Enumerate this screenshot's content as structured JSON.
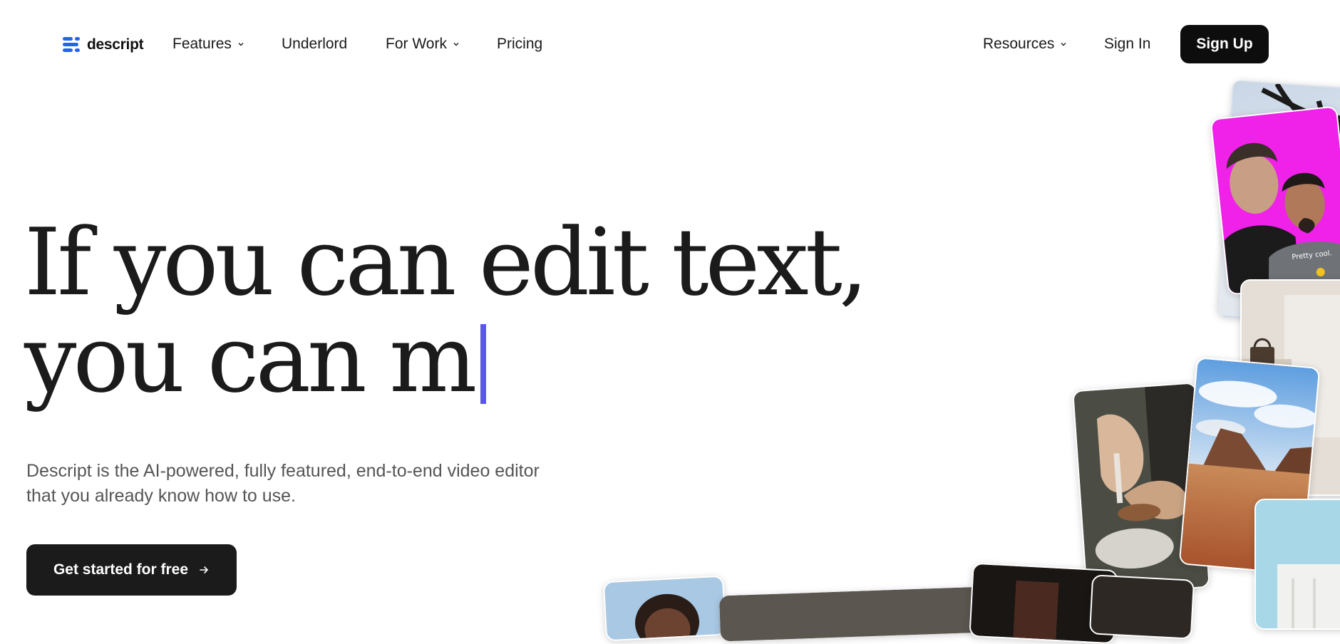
{
  "brand": {
    "name": "descript",
    "accent": "#2463eb"
  },
  "nav": {
    "features": "Features",
    "underlord": "Underlord",
    "for_work": "For Work",
    "pricing": "Pricing",
    "resources": "Resources",
    "sign_in": "Sign In",
    "sign_up": "Sign Up"
  },
  "hero": {
    "headline_line1": "If you can edit text,",
    "headline_line2": "you can m",
    "subtext_line1": "Descript is the AI-powered, fully featured, end-to-end video editor",
    "subtext_line2": "that you already know how to use.",
    "cta_label": "Get started for free",
    "caret_color": "#5a56f0"
  },
  "collage": {
    "caption_pretty_cool": "Pretty cool.",
    "magenta_bg": "#f021e8"
  }
}
